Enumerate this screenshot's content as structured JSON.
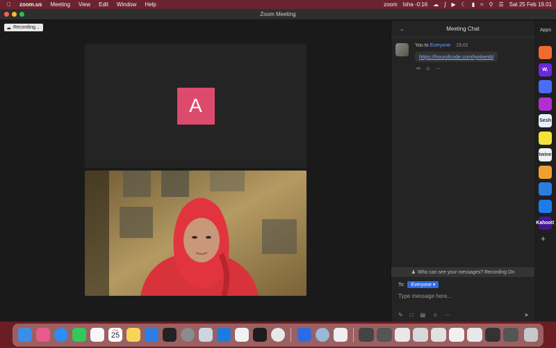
{
  "menubar": {
    "app_name": "zoom.us",
    "menus": [
      "Meeting",
      "View",
      "Edit",
      "Window",
      "Help"
    ],
    "status_app": "zoom",
    "user_status": "Isha -0:16",
    "datetime": "Sat 25 Feb  19.01"
  },
  "window": {
    "title": "Zoom Meeting"
  },
  "recording": {
    "label": "Recording..."
  },
  "participant": {
    "initial": "A",
    "color": "#dc4b6e"
  },
  "chat": {
    "title": "Meeting Chat",
    "message": {
      "from": "You to",
      "to": "Everyone",
      "time": "19.01",
      "link": "https://hourofcode.com/tynkerdd"
    },
    "privacy_notice": "Who can see your messages? Recording On",
    "to_label": "To:",
    "recipient": "Everyone",
    "input_placeholder": "Type message here..."
  },
  "apps": {
    "title": "Apps",
    "items": [
      {
        "icon": "app-orange-icon",
        "label": "",
        "color": "#f26a2e"
      },
      {
        "icon": "app-w-icon",
        "label": "W.",
        "color": "#6a2ad8"
      },
      {
        "icon": "app-chat-icon",
        "label": "",
        "color": "#4a6cf7"
      },
      {
        "icon": "app-purple-icon",
        "label": "",
        "color": "#b12fd0"
      },
      {
        "icon": "app-sesh-icon",
        "label": "Sesh",
        "color": "#e8f0ff"
      },
      {
        "icon": "app-face-icon",
        "label": "",
        "color": "#f4e23a"
      },
      {
        "icon": "app-twine-icon",
        "label": "twine",
        "color": "#f2f2f2"
      },
      {
        "icon": "app-grid-icon",
        "label": "",
        "color": "#f0a030"
      },
      {
        "icon": "app-sync-icon",
        "label": "",
        "color": "#2b7de0"
      },
      {
        "icon": "app-e-icon",
        "label": "",
        "color": "#1d7ce8"
      },
      {
        "icon": "app-kahoot-icon",
        "label": "Kahoot!",
        "color": "#46178f"
      }
    ]
  },
  "dock": {
    "calendar_day": "25",
    "calendar_month": "FEB"
  }
}
